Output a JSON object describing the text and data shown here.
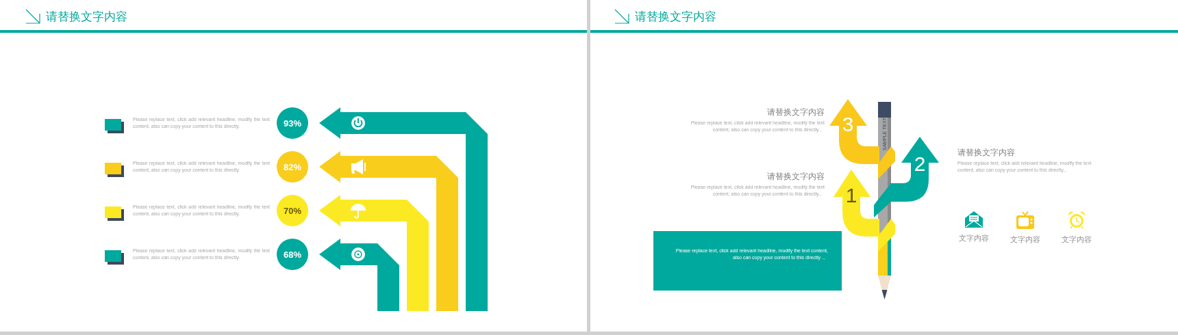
{
  "left_slide": {
    "title": "请替换文字内容",
    "items": [
      {
        "text": "Please replace text, click add relevant headline, modify the text content, also can copy your content to this directly.",
        "percent": "93%",
        "color": "#00a99d"
      },
      {
        "text": "Please replace text, click add relevant headline, modify the text content, also can copy your content to this directly.",
        "percent": "82%",
        "color": "#f9cd1b"
      },
      {
        "text": "Please replace text, click add relevant headline, modify the text content, also can copy your content to this directly.",
        "percent": "70%",
        "color": "#fbea23"
      },
      {
        "text": "Please replace text, click add relevant headline, modify the text content, also can copy your content to this directly.",
        "percent": "68%",
        "color": "#00a99d"
      }
    ]
  },
  "right_slide": {
    "title": "请替换文字内容",
    "notes": [
      {
        "heading": "请替换文字内容",
        "text": "Please replace text, click add relevant headline, modify the text content, also can copy your content to this directly.。"
      },
      {
        "heading": "请替换文字内容",
        "text": "Please replace text, click add relevant headline, modify the text content, also can copy your content to this directly.。"
      },
      {
        "heading": "请替换文字内容",
        "text": "Please replace text, click add relevant headline, modify the text content, also can copy your content to this directly.。"
      }
    ],
    "arrows": [
      {
        "number": "3",
        "color": "#f9c81b"
      },
      {
        "number": "2",
        "color": "#00a99d"
      },
      {
        "number": "1",
        "color": "#fbea23"
      }
    ],
    "pencil_label": "SAMPLE TEXT",
    "box_text": "Please replace text, click add relevant headline, modify the text content, also can copy your content to this directly .。",
    "icons": [
      {
        "label": "文字内容",
        "color": "#00a99d"
      },
      {
        "label": "文字内容",
        "color": "#f9c81b"
      },
      {
        "label": "文字内容",
        "color": "#fbe823"
      }
    ]
  }
}
